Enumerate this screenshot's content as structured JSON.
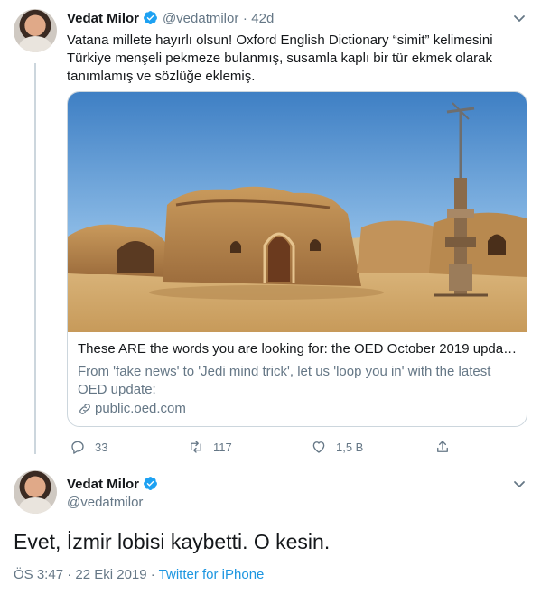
{
  "tweet1": {
    "name": "Vedat Milor",
    "handle": "@vedatmilor",
    "dot": "·",
    "age": "42d",
    "text": "Vatana millete hayırlı olsun! Oxford English Dictionary “simit” kelimesini Türkiye menşeli pekmeze bulanmış, susamla kaplı bir tür ekmek olarak tanımlamış ve sözlüğe eklemiş.",
    "card": {
      "title": "These ARE the words you are looking for: the OED October 2019 update...",
      "description": "From 'fake news' to 'Jedi mind trick', let us 'loop you in' with the latest OED update:",
      "link": "public.oed.com"
    },
    "actions": {
      "replies": "33",
      "retweets": "117",
      "likes": "1,5 B",
      "share": ""
    }
  },
  "tweet2": {
    "name": "Vedat Milor",
    "handle": "@vedatmilor",
    "text": "Evet, İzmir lobisi kaybetti. O kesin.",
    "timestamp": "ÖS 3:47 · 22 Eki 2019",
    "meta_sep": " · ",
    "source": "Twitter for iPhone"
  },
  "colors": {
    "accent": "#1da1f2",
    "text": "#14171a",
    "secondary": "#657786",
    "border": "#ccd6dd",
    "link": "#1b95e0"
  },
  "icons": [
    "verified-badge-icon",
    "chevron-down-icon",
    "reply-icon",
    "retweet-icon",
    "like-icon",
    "share-icon",
    "link-icon"
  ]
}
